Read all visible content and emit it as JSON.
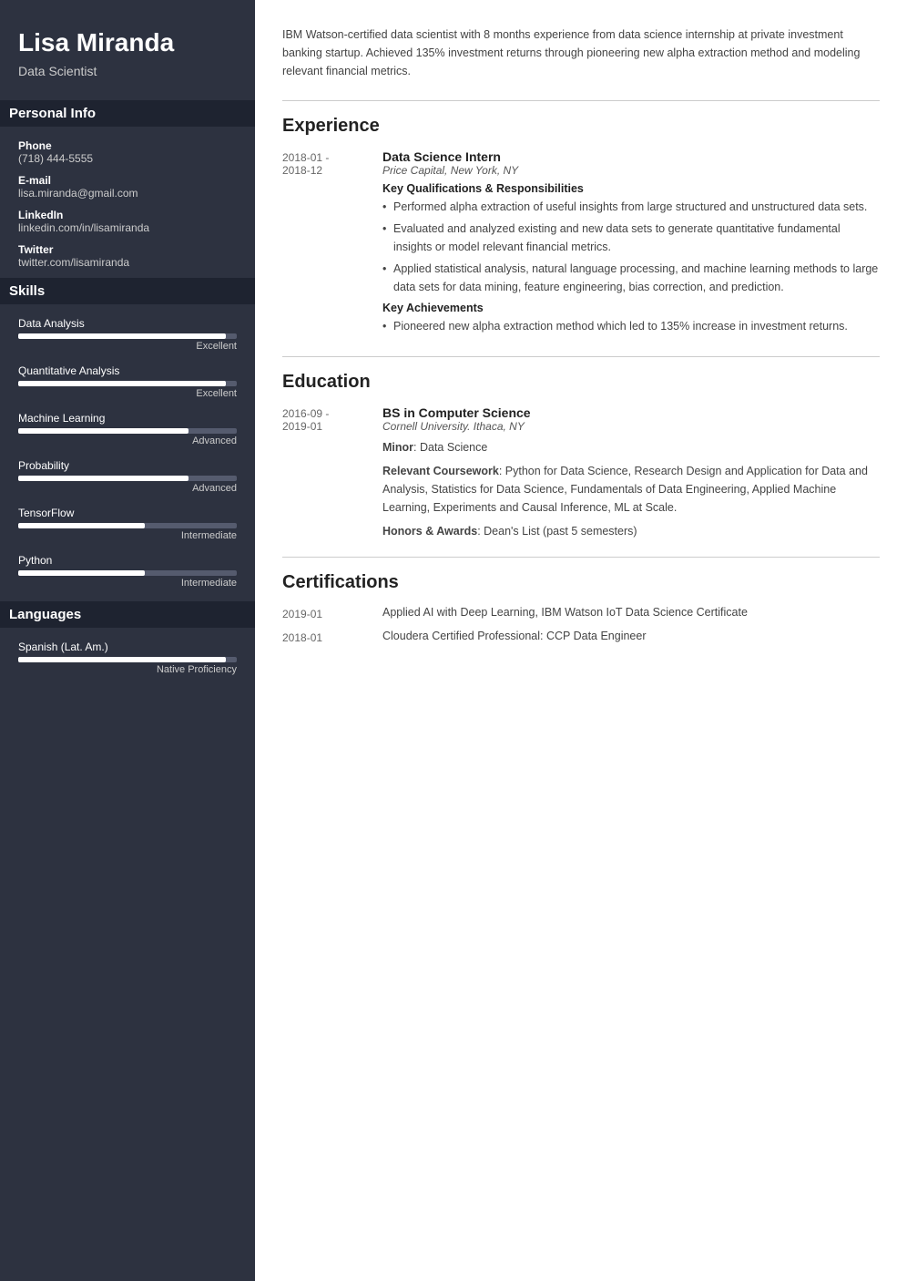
{
  "sidebar": {
    "name": "Lisa Miranda",
    "title": "Data Scientist",
    "sections": {
      "personal": {
        "label": "Personal Info",
        "items": [
          {
            "label": "Phone",
            "value": "(718) 444-5555"
          },
          {
            "label": "E-mail",
            "value": "lisa.miranda@gmail.com"
          },
          {
            "label": "LinkedIn",
            "value": "linkedin.com/in/lisamiranda"
          },
          {
            "label": "Twitter",
            "value": "twitter.com/lisamiranda"
          }
        ]
      },
      "skills": {
        "label": "Skills",
        "items": [
          {
            "name": "Data Analysis",
            "level": "Excellent",
            "percent": 95
          },
          {
            "name": "Quantitative Analysis",
            "level": "Excellent",
            "percent": 95
          },
          {
            "name": "Machine Learning",
            "level": "Advanced",
            "percent": 78
          },
          {
            "name": "Probability",
            "level": "Advanced",
            "percent": 78
          },
          {
            "name": "TensorFlow",
            "level": "Intermediate",
            "percent": 58
          },
          {
            "name": "Python",
            "level": "Intermediate",
            "percent": 58
          }
        ]
      },
      "languages": {
        "label": "Languages",
        "items": [
          {
            "name": "Spanish (Lat. Am.)",
            "level": "Native Proficiency",
            "percent": 95
          }
        ]
      }
    }
  },
  "main": {
    "summary": "IBM Watson-certified data scientist with 8 months experience from data science internship at private investment banking startup. Achieved 135% investment returns through pioneering new alpha extraction method and modeling relevant financial metrics.",
    "experience": {
      "label": "Experience",
      "entries": [
        {
          "date_start": "2018-01 -",
          "date_end": "2018-12",
          "title": "Data Science Intern",
          "subtitle": "Price Capital, New York, NY",
          "qualifications_label": "Key Qualifications & Responsibilities",
          "qualifications": [
            "Performed alpha extraction of useful insights from large structured and unstructured data sets.",
            "Evaluated and analyzed existing and new data sets to generate quantitative fundamental insights or model relevant financial metrics.",
            "Applied statistical analysis, natural language processing, and machine learning methods to large data sets for data mining, feature engineering, bias correction, and prediction."
          ],
          "achievements_label": "Key Achievements",
          "achievements": [
            "Pioneered new alpha extraction method which led to 135% increase in investment returns."
          ]
        }
      ]
    },
    "education": {
      "label": "Education",
      "entries": [
        {
          "date_start": "2016-09 -",
          "date_end": "2019-01",
          "title": "BS in Computer Science",
          "subtitle": "Cornell University. Ithaca, NY",
          "minor_label": "Minor",
          "minor": "Data Science",
          "coursework_label": "Relevant Coursework",
          "coursework": "Python for Data Science, Research Design and Application for Data and Analysis, Statistics for Data Science, Fundamentals of Data Engineering, Applied Machine Learning, Experiments and Causal Inference, ML at Scale.",
          "honors_label": "Honors & Awards",
          "honors": "Dean's List (past 5 semesters)"
        }
      ]
    },
    "certifications": {
      "label": "Certifications",
      "entries": [
        {
          "date": "2019-01",
          "text": "Applied AI with Deep Learning, IBM Watson IoT Data Science Certificate"
        },
        {
          "date": "2018-01",
          "text": "Cloudera Certified Professional: CCP Data Engineer"
        }
      ]
    }
  }
}
